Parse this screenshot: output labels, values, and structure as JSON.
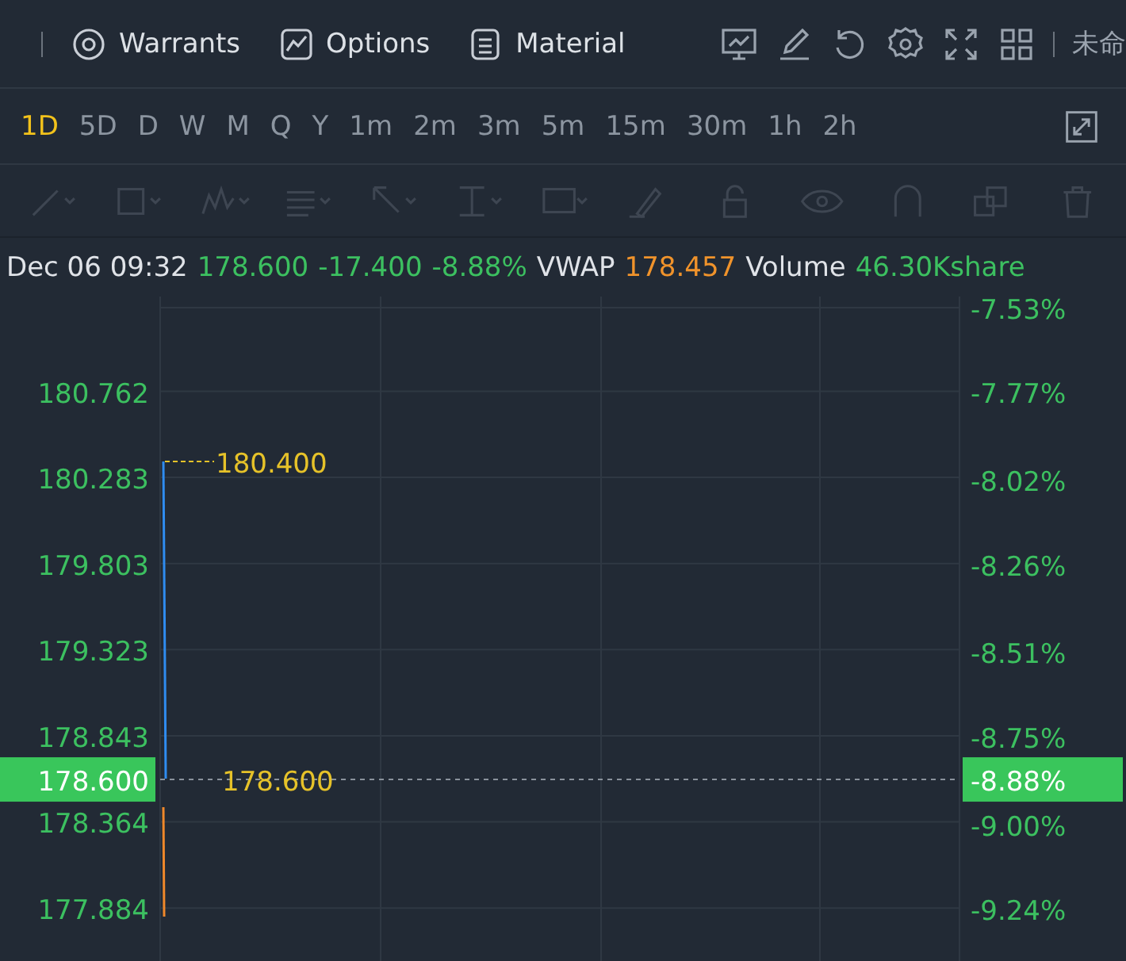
{
  "top_bar": {
    "tabs": [
      {
        "label": "Warrants"
      },
      {
        "label": "Options"
      },
      {
        "label": "Material"
      }
    ],
    "truncated_label": "未命"
  },
  "periods": [
    {
      "label": "1D",
      "selected": true
    },
    {
      "label": "5D",
      "selected": false
    },
    {
      "label": "D",
      "selected": false
    },
    {
      "label": "W",
      "selected": false
    },
    {
      "label": "M",
      "selected": false
    },
    {
      "label": "Q",
      "selected": false
    },
    {
      "label": "Y",
      "selected": false
    },
    {
      "label": "1m",
      "selected": false
    },
    {
      "label": "2m",
      "selected": false
    },
    {
      "label": "3m",
      "selected": false
    },
    {
      "label": "5m",
      "selected": false
    },
    {
      "label": "15m",
      "selected": false
    },
    {
      "label": "30m",
      "selected": false
    },
    {
      "label": "1h",
      "selected": false
    },
    {
      "label": "2h",
      "selected": false
    }
  ],
  "info": {
    "time": "Dec 06 09:32",
    "price": "178.600",
    "change": "-17.400",
    "change_pct": "-8.88%",
    "vwap_label": "VWAP",
    "vwap": "178.457",
    "volume_label": "Volume",
    "volume": "46.30Kshare"
  },
  "chart": {
    "chart_data": {
      "type": "line",
      "grid": true,
      "ylim": [
        177.58,
        181.29
      ],
      "categories": [
        null,
        null
      ],
      "yticks": [
        {
          "value": 180.762,
          "label": "180.762"
        },
        {
          "value": 180.283,
          "label": "180.283"
        },
        {
          "value": 179.803,
          "label": "179.803"
        },
        {
          "value": 179.323,
          "label": "179.323"
        },
        {
          "value": 178.843,
          "label": "178.843"
        },
        {
          "value": 178.364,
          "label": "178.364"
        },
        {
          "value": 177.884,
          "label": "177.884"
        }
      ],
      "ref_lines": [
        {
          "axis": "y",
          "value": 178.6,
          "label": "178.600"
        }
      ],
      "annotations": [
        "180.400"
      ]
    },
    "right_axis": [
      "-7.53%",
      "-7.77%",
      "-8.02%",
      "-8.26%",
      "-8.51%",
      "-8.75%",
      "-9.00%",
      "-9.24%"
    ],
    "last_price": {
      "label": "178.600",
      "pct": "-8.88%"
    }
  }
}
